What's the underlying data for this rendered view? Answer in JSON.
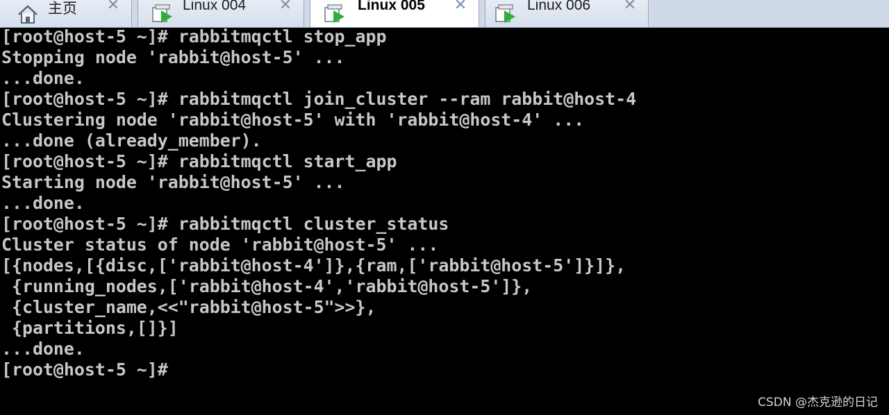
{
  "tabs": [
    {
      "label": "主页",
      "icon": "home-icon",
      "close": "✕"
    },
    {
      "label": "Linux 004",
      "icon": "vm-play-icon",
      "close": "✕"
    },
    {
      "label": "Linux 005",
      "icon": "vm-play-icon",
      "close": "✕",
      "active": true
    },
    {
      "label": "Linux 006",
      "icon": "vm-play-icon",
      "close": "✕"
    }
  ],
  "terminal": {
    "lines": [
      "[root@host-5 ~]# rabbitmqctl stop_app",
      "Stopping node 'rabbit@host-5' ...",
      "...done.",
      "[root@host-5 ~]# rabbitmqctl join_cluster --ram rabbit@host-4",
      "Clustering node 'rabbit@host-5' with 'rabbit@host-4' ...",
      "...done (already_member).",
      "[root@host-5 ~]# rabbitmqctl start_app",
      "Starting node 'rabbit@host-5' ...",
      "...done.",
      "[root@host-5 ~]# rabbitmqctl cluster_status",
      "Cluster status of node 'rabbit@host-5' ...",
      "[{nodes,[{disc,['rabbit@host-4']},{ram,['rabbit@host-5']}]},",
      " {running_nodes,['rabbit@host-4','rabbit@host-5']},",
      " {cluster_name,<<\"rabbit@host-5\">>},",
      " {partitions,[]}]",
      "...done.",
      "[root@host-5 ~]#"
    ]
  },
  "watermark": "CSDN @杰克逊的日记"
}
